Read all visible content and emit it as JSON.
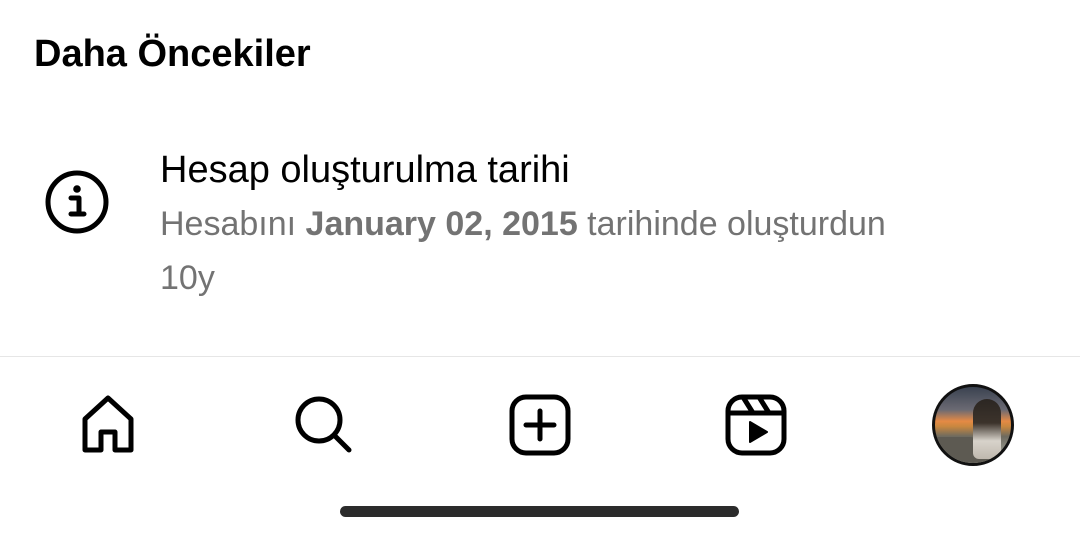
{
  "section": {
    "title": "Daha Öncekiler"
  },
  "account_info": {
    "icon": "info-icon",
    "title": "Hesap oluşturulma tarihi",
    "subtitle_prefix": "Hesabını ",
    "date": "January 02, 2015",
    "subtitle_suffix": " tarihinde oluşturdun",
    "age": "10y"
  },
  "tabbar": {
    "items": [
      {
        "name": "home",
        "icon": "home-icon"
      },
      {
        "name": "search",
        "icon": "search-icon"
      },
      {
        "name": "create",
        "icon": "plus-square-icon"
      },
      {
        "name": "reels",
        "icon": "reels-icon"
      },
      {
        "name": "profile",
        "icon": "avatar"
      }
    ]
  },
  "colors": {
    "primary_text": "#000000",
    "secondary_text": "#737373",
    "divider": "#e6e6e6",
    "home_indicator": "#2b2b2b"
  }
}
